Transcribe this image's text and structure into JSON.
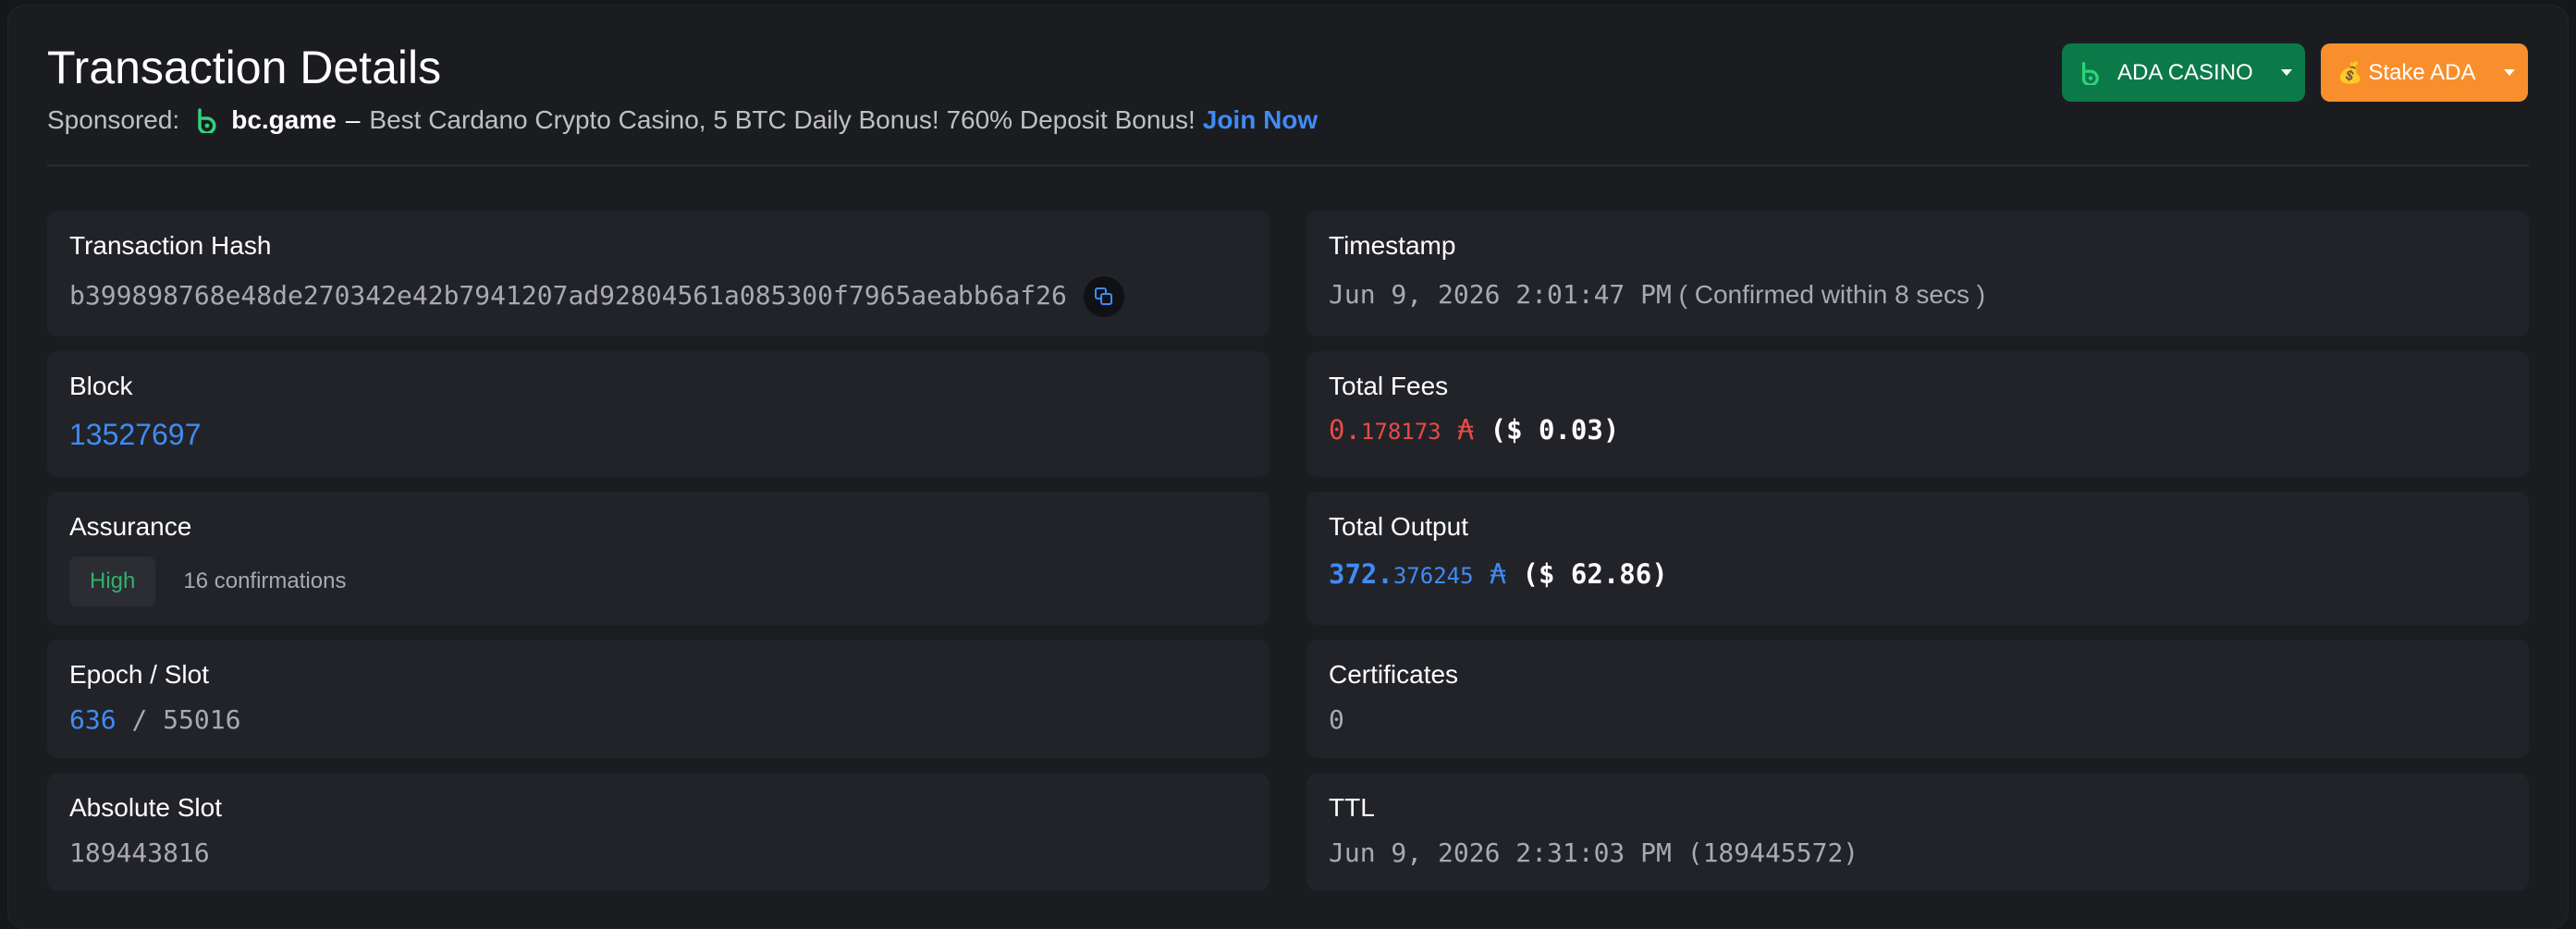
{
  "header": {
    "title": "Transaction Details",
    "sponsored_label": "Sponsored:",
    "sponsor_brand": "bc.game",
    "sponsor_dash": "–",
    "sponsor_text": "Best Cardano Crypto Casino, 5 BTC Daily Bonus! 760% Deposit Bonus!",
    "sponsor_cta": "Join Now"
  },
  "buttons": {
    "casino_label": "ADA CASINO",
    "stake_label": "Stake ADA"
  },
  "colors": {
    "casino_bg": "#0b7a48",
    "stake_bg": "#f98f2c",
    "link": "#3f8bf5",
    "fee_red": "#e74b46",
    "assurance_green": "#2fb36b"
  },
  "left": {
    "hash": {
      "label": "Transaction Hash",
      "value": "b399898768e48de270342e42b7941207ad92804561a085300f7965aeabb6af26"
    },
    "block": {
      "label": "Block",
      "value": "13527697"
    },
    "assurance": {
      "label": "Assurance",
      "level": "High",
      "confirmations": "16 confirmations"
    },
    "epoch_slot": {
      "label": "Epoch / Slot",
      "epoch": "636",
      "sep": "/",
      "slot": "55016"
    },
    "absolute_slot": {
      "label": "Absolute Slot",
      "value": "189443816"
    }
  },
  "right": {
    "timestamp": {
      "label": "Timestamp",
      "value": "Jun 9, 2026 2:01:47 PM",
      "note": "( Confirmed within 8 secs )"
    },
    "fees": {
      "label": "Total Fees",
      "int": "0.",
      "dec": "178173",
      "symbol": "₳",
      "usd": "($ 0.03)"
    },
    "output": {
      "label": "Total Output",
      "int": "372.",
      "dec": "376245",
      "symbol": "₳",
      "usd": "($ 62.86)"
    },
    "certificates": {
      "label": "Certificates",
      "value": "0"
    },
    "ttl": {
      "label": "TTL",
      "value": "Jun 9, 2026 2:31:03 PM (189445572)"
    }
  },
  "icons": {
    "sponsor_logo": "bc-game-logo-icon",
    "casino_logo": "bc-game-logo-icon",
    "copy": "copy-icon",
    "money_bag": "money-bag-icon",
    "caret": "caret-down-icon"
  }
}
